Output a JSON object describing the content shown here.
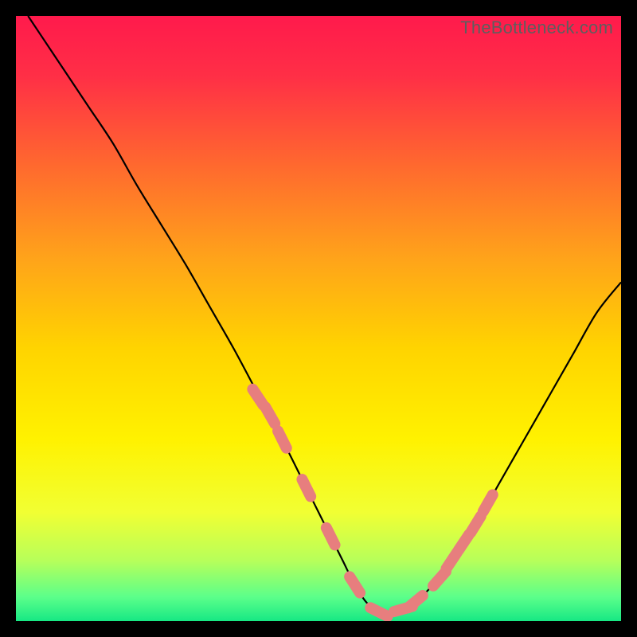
{
  "watermark": "TheBottleneck.com",
  "colors": {
    "frame": "#000000",
    "gradient_stops": [
      {
        "offset": 0.0,
        "color": "#ff1a4c"
      },
      {
        "offset": 0.1,
        "color": "#ff2f46"
      },
      {
        "offset": 0.25,
        "color": "#ff6a2e"
      },
      {
        "offset": 0.4,
        "color": "#ffa31a"
      },
      {
        "offset": 0.55,
        "color": "#ffd400"
      },
      {
        "offset": 0.7,
        "color": "#fff200"
      },
      {
        "offset": 0.82,
        "color": "#f1ff33"
      },
      {
        "offset": 0.9,
        "color": "#b7ff5a"
      },
      {
        "offset": 0.96,
        "color": "#5cff8a"
      },
      {
        "offset": 1.0,
        "color": "#17e884"
      }
    ],
    "curve": "#000000",
    "marker_fill": "#e77e7e",
    "marker_stroke": "#d86b6b"
  },
  "chart_data": {
    "type": "line",
    "title": "",
    "xlabel": "",
    "ylabel": "",
    "xlim": [
      0,
      100
    ],
    "ylim": [
      0,
      100
    ],
    "series": [
      {
        "name": "bottleneck-curve",
        "x": [
          2,
          4,
          8,
          12,
          16,
          20,
          24,
          28,
          32,
          36,
          40,
          44,
          48,
          52,
          54,
          56,
          58,
          60,
          62,
          64,
          68,
          72,
          76,
          80,
          84,
          88,
          92,
          96,
          100
        ],
        "y": [
          100,
          97,
          91,
          85,
          79,
          72,
          65.5,
          59,
          52,
          45,
          37.5,
          30,
          22,
          14,
          10,
          6,
          3,
          1.5,
          1,
          2,
          5,
          10,
          16,
          23,
          30,
          37,
          44,
          51,
          56
        ]
      }
    ],
    "markers": {
      "name": "highlighted-points",
      "x": [
        40,
        42,
        44,
        48,
        52,
        56,
        60,
        64,
        66,
        70,
        72,
        74,
        76,
        78
      ],
      "y": [
        37,
        34,
        30,
        22,
        14,
        6,
        1.5,
        2,
        3.2,
        7,
        10,
        13,
        16,
        19.5
      ]
    }
  }
}
